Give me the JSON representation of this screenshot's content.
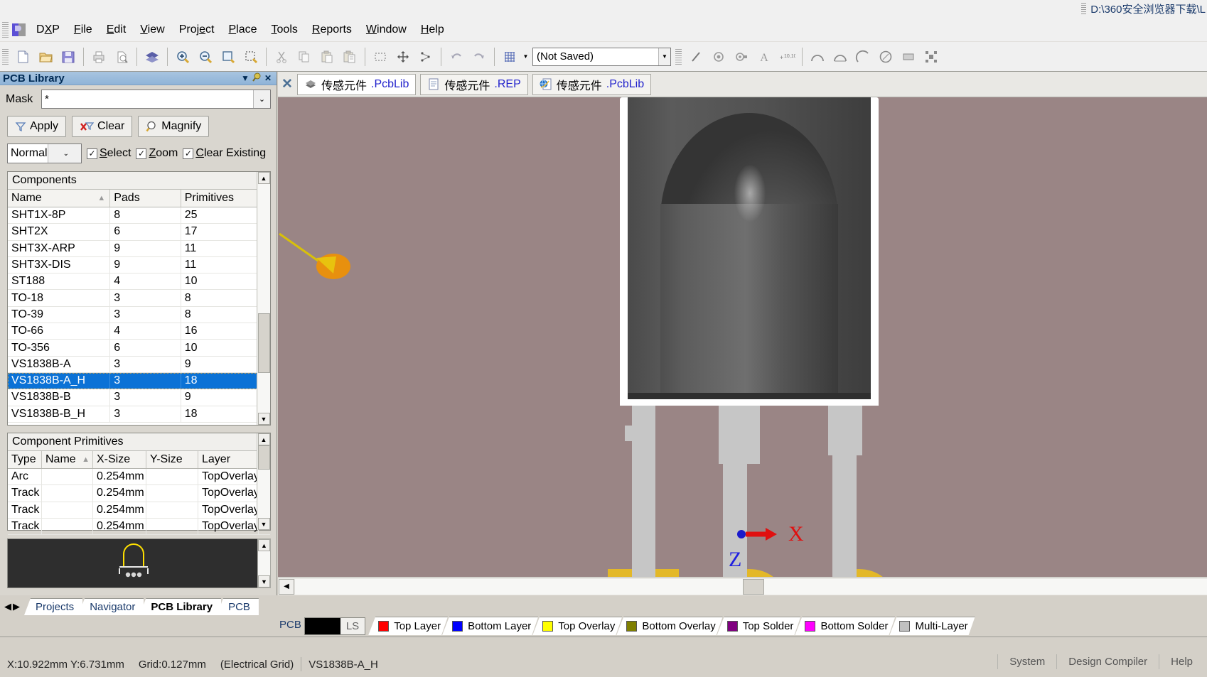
{
  "window": {
    "top_path": "D:\\360安全浏览器下载\\L"
  },
  "menubar": {
    "logo_label": "DXP",
    "items": [
      {
        "label": "File"
      },
      {
        "label": "Edit"
      },
      {
        "label": "View"
      },
      {
        "label": "Project"
      },
      {
        "label": "Place"
      },
      {
        "label": "Tools"
      },
      {
        "label": "Reports"
      },
      {
        "label": "Window"
      },
      {
        "label": "Help"
      }
    ]
  },
  "toolbar": {
    "document_selector": "(Not Saved)",
    "icons": [
      "new-document-icon",
      "open-folder-icon",
      "save-icon",
      "print-icon",
      "print-preview-icon",
      "board-layers-icon",
      "zoom-in-icon",
      "zoom-out-icon",
      "zoom-document-icon",
      "zoom-area-icon",
      "cut-icon",
      "copy-icon",
      "paste-icon",
      "paste-special-icon",
      "select-area-icon",
      "move-icon",
      "align-icon",
      "undo-icon",
      "redo-icon",
      "grid-icon",
      "place-line-icon",
      "place-via-icon",
      "place-pad-icon",
      "place-string-icon",
      "place-coordinate-icon",
      "arc-center-icon",
      "arc-edge-icon",
      "arc-any-angle-icon",
      "full-circle-icon",
      "place-fill-icon",
      "component-icon"
    ]
  },
  "panel": {
    "title": "PCB Library",
    "mask": {
      "label": "Mask",
      "value": "*",
      "placeholder": ""
    },
    "buttons": [
      {
        "label": "Apply",
        "icon": "funnel-icon"
      },
      {
        "label": "Clear",
        "icon": "clear-filter-icon"
      },
      {
        "label": "Magnify",
        "icon": "magnifier-icon"
      }
    ],
    "mode_select": "Normal",
    "checkboxes": [
      {
        "label": "Select",
        "checked": true
      },
      {
        "label": "Zoom",
        "checked": true
      },
      {
        "label": "Clear Existing",
        "checked": true
      }
    ],
    "components_table": {
      "caption": "Components",
      "columns": [
        "Name",
        "Pads",
        "Primitives"
      ],
      "sort_column": "Name",
      "sort_direction": "ascending",
      "selected_row_index": 10,
      "rows": [
        {
          "name": "SHT1X-8P",
          "pads": "8",
          "primitives": "25"
        },
        {
          "name": "SHT2X",
          "pads": "6",
          "primitives": "17"
        },
        {
          "name": "SHT3X-ARP",
          "pads": "9",
          "primitives": "11"
        },
        {
          "name": "SHT3X-DIS",
          "pads": "9",
          "primitives": "11"
        },
        {
          "name": "ST188",
          "pads": "4",
          "primitives": "10"
        },
        {
          "name": "TO-18",
          "pads": "3",
          "primitives": "8"
        },
        {
          "name": "TO-39",
          "pads": "3",
          "primitives": "8"
        },
        {
          "name": "TO-66",
          "pads": "4",
          "primitives": "16"
        },
        {
          "name": "TO-356",
          "pads": "6",
          "primitives": "10"
        },
        {
          "name": "VS1838B-A",
          "pads": "3",
          "primitives": "9"
        },
        {
          "name": "VS1838B-A_H",
          "pads": "3",
          "primitives": "18"
        },
        {
          "name": "VS1838B-B",
          "pads": "3",
          "primitives": "9"
        },
        {
          "name": "VS1838B-B_H",
          "pads": "3",
          "primitives": "18"
        }
      ]
    },
    "primitives_table": {
      "caption": "Component Primitives",
      "columns": [
        "Type",
        "Name",
        "X-Size",
        "Y-Size",
        "Layer"
      ],
      "sort_column": "Name",
      "rows": [
        {
          "type": "Arc",
          "name": "",
          "xsize": "0.254mm",
          "ysize": "",
          "layer": "TopOverlay"
        },
        {
          "type": "Track",
          "name": "",
          "xsize": "0.254mm",
          "ysize": "",
          "layer": "TopOverlay"
        },
        {
          "type": "Track",
          "name": "",
          "xsize": "0.254mm",
          "ysize": "",
          "layer": "TopOverlay"
        },
        {
          "type": "Track",
          "name": "",
          "xsize": "0.254mm",
          "ysize": "",
          "layer": "TopOverlay"
        }
      ]
    },
    "preview_label": "component-preview"
  },
  "panel_tabs": {
    "items": [
      {
        "label": "Projects",
        "active": false
      },
      {
        "label": "Navigator",
        "active": false
      },
      {
        "label": "PCB Library",
        "active": true
      },
      {
        "label": "PCB",
        "active": false
      }
    ]
  },
  "document_tabs": [
    {
      "label_cn": "传感元件",
      "ext": ".PcbLib",
      "icon": "pcblib-icon",
      "active": true
    },
    {
      "label_cn": "传感元件",
      "ext": ".REP",
      "icon": "report-icon",
      "active": false
    },
    {
      "label_cn": "传感元件",
      "ext": ".PcbLib",
      "icon": "browser-icon",
      "active": false
    }
  ],
  "canvas": {
    "background_color": "#9a8585",
    "component": "VS1838B-A_H",
    "axis": {
      "x_label": "X",
      "z_label": "Z",
      "origin_marker": "origin-dot"
    }
  },
  "layer_bar": {
    "pcb_label": "PCB",
    "ls_label": "LS",
    "tabs": [
      {
        "label": "Top Layer",
        "color": "#ff0000"
      },
      {
        "label": "Bottom Layer",
        "color": "#0000ff"
      },
      {
        "label": "Top Overlay",
        "color": "#ffff00"
      },
      {
        "label": "Bottom Overlay",
        "color": "#808000"
      },
      {
        "label": "Top Solder",
        "color": "#800080"
      },
      {
        "label": "Bottom Solder",
        "color": "#ff00ff"
      },
      {
        "label": "Multi-Layer",
        "color": "#c0c0c0"
      }
    ]
  },
  "status_bar": {
    "coordinates": "X:10.922mm Y:6.731mm",
    "grid": "Grid:0.127mm",
    "mode": "(Electrical Grid)",
    "component": "VS1838B-A_H",
    "system_buttons": [
      "System",
      "Design Compiler",
      "Help"
    ]
  }
}
